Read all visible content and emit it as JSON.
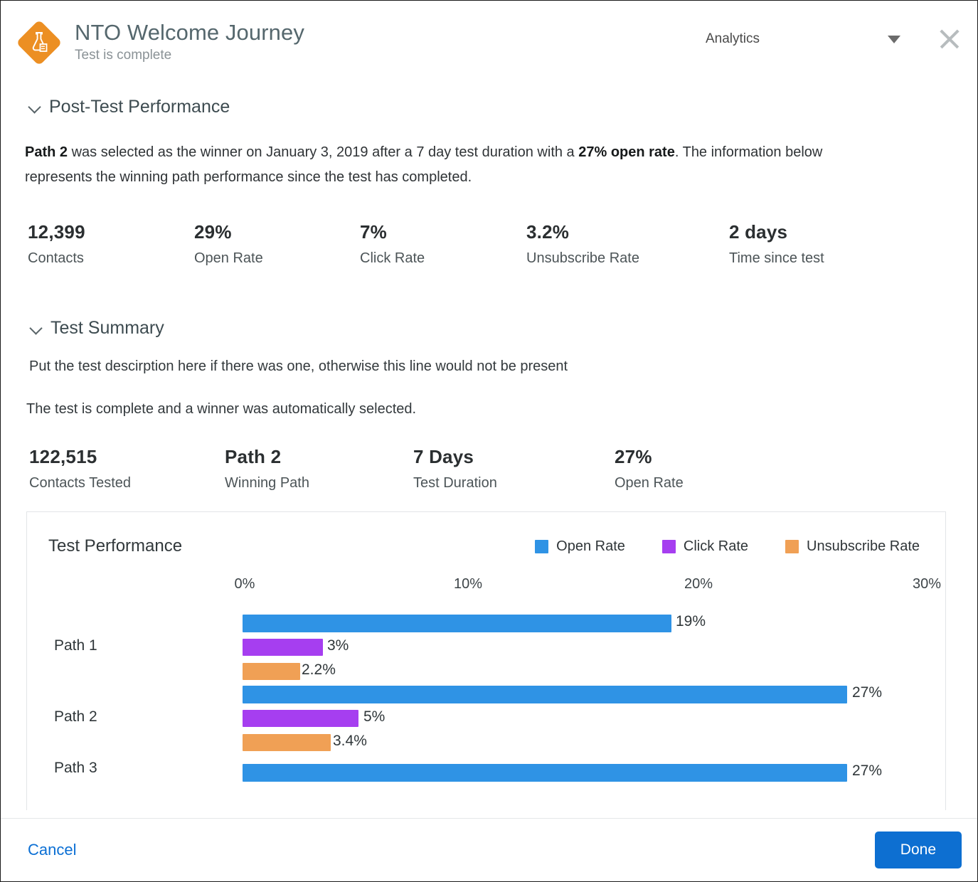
{
  "header": {
    "logo_icon": "flask-icon",
    "title": "NTO Welcome Journey",
    "subtitle": "Test is complete",
    "view_selector_value": "Analytics",
    "caret_icon": "chevron-down-icon",
    "close_icon": "close-icon"
  },
  "post_test": {
    "section_title": "Post-Test Performance",
    "chevron_icon": "chevron-down-icon",
    "summary_parts": {
      "b1": "Path 2",
      "t1": " was selected as the winner on January 3, 2019 after a 7 day test duration with a ",
      "b2": "27% open rate",
      "t2": ".  The information below represents the winning path performance since the test has completed."
    },
    "kpis": [
      {
        "value": "12,399",
        "label": "Contacts"
      },
      {
        "value": "29%",
        "label": "Open Rate"
      },
      {
        "value": "7%",
        "label": "Click Rate"
      },
      {
        "value": "3.2%",
        "label": "Unsubscribe Rate"
      },
      {
        "value": "2 days",
        "label": "Time since test"
      }
    ]
  },
  "test_summary": {
    "section_title": "Test Summary",
    "chevron_icon": "chevron-down-icon",
    "description": "Put the test descirption here if there was one, otherwise this line would not be present",
    "status_line": "The test is complete and a winner was automatically selected.",
    "kpis": [
      {
        "value": "122,515",
        "label": "Contacts Tested"
      },
      {
        "value": "Path 2",
        "label": "Winning Path"
      },
      {
        "value": "7 Days",
        "label": "Test Duration"
      },
      {
        "value": "27%",
        "label": "Open Rate"
      }
    ]
  },
  "chart_data": {
    "type": "bar",
    "orientation": "horizontal",
    "title": "Test Performance",
    "xlabel": "",
    "ylabel": "",
    "xlim": [
      0,
      30
    ],
    "xticks": [
      0,
      10,
      20,
      30
    ],
    "xtick_labels": [
      "0%",
      "10%",
      "20%",
      "30%"
    ],
    "grid": false,
    "legend_position": "top-right",
    "categories": [
      "Path 1",
      "Path 2",
      "Path 3"
    ],
    "series": [
      {
        "name": "Open Rate",
        "color": "#2f93e5",
        "values": [
          19,
          27,
          27
        ],
        "labels": [
          "19%",
          "27%",
          "27%"
        ]
      },
      {
        "name": "Click Rate",
        "color": "#a63ef0",
        "values": [
          3,
          5,
          null
        ],
        "labels": [
          "3%",
          "5%",
          null
        ]
      },
      {
        "name": "Unsubscribe Rate",
        "color": "#f0a055",
        "values": [
          2.2,
          3.4,
          null
        ],
        "labels": [
          "2.2%",
          "3.4%",
          null
        ]
      }
    ]
  },
  "footer": {
    "cancel_label": "Cancel",
    "done_label": "Done"
  },
  "colors": {
    "open_rate": "#2f93e5",
    "click_rate": "#a63ef0",
    "unsubscribe_rate": "#f0a055",
    "brand_orange": "#ec8f23",
    "primary_blue": "#0d6fd1"
  }
}
